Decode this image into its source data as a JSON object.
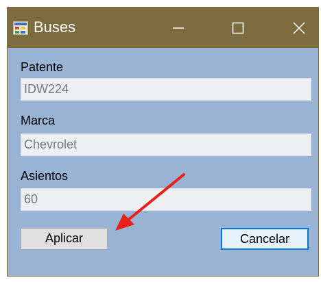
{
  "window": {
    "title": "Buses",
    "controls": {
      "minimize": "minimize-icon",
      "maximize": "maximize-icon",
      "close": "close-icon"
    }
  },
  "form": {
    "patente": {
      "label": "Patente",
      "value": "IDW224"
    },
    "marca": {
      "label": "Marca",
      "value": "Chevrolet"
    },
    "asientos": {
      "label": "Asientos",
      "value": "60"
    }
  },
  "buttons": {
    "apply": "Aplicar",
    "cancel": "Cancelar"
  },
  "colors": {
    "titlebar": "#7c6c3f",
    "client_area": "#98b3d3",
    "annotation_arrow": "#e8221b",
    "focus_border": "#0078d7"
  }
}
